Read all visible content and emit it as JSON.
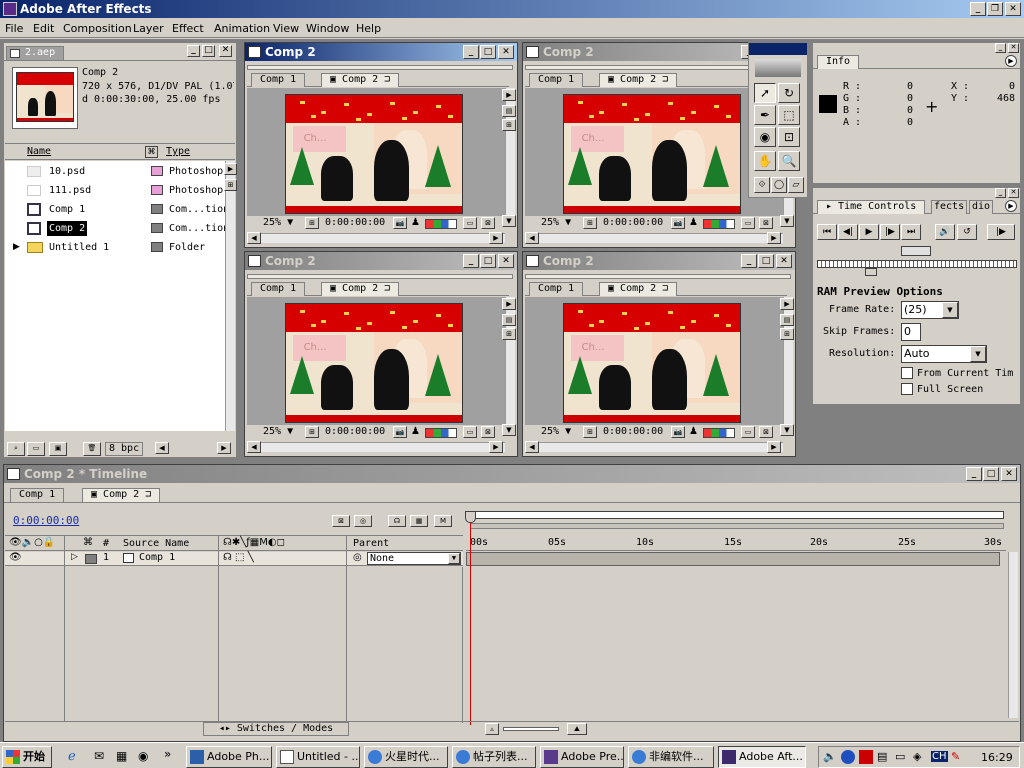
{
  "app": {
    "title": "Adobe After Effects"
  },
  "menu": [
    "File",
    "Edit",
    "Composition",
    "Layer",
    "Effect",
    "Animation",
    "View",
    "Window",
    "Help"
  ],
  "project": {
    "tab": "2.aep",
    "preview_name": "Comp 2",
    "preview_info1": "720 x 576, D1/DV PAL (1.07",
    "preview_info2": "d 0:00:30:00, 25.00 fps",
    "col_name": "Name",
    "col_type": "Type",
    "items": [
      {
        "name": "10.psd",
        "type": "Photoshop",
        "color": "#e8a0d8"
      },
      {
        "name": "111.psd",
        "type": "Photoshop",
        "color": "#e8a0d8"
      },
      {
        "name": "Comp 1",
        "type": "Com...tion",
        "color": "#808080"
      },
      {
        "name": "Comp 2",
        "type": "Com...tion",
        "color": "#808080"
      },
      {
        "name": "Untitled 1",
        "type": "Folder",
        "color": "#808080"
      }
    ],
    "bpc": "8 bpc"
  },
  "comp_windows": [
    {
      "title": "Comp 2",
      "tab1": "Comp 1",
      "tab2": "Comp 2",
      "zoom": "25%",
      "time": "0:00:00:00"
    },
    {
      "title": "Comp 2",
      "tab1": "Comp 1",
      "tab2": "Comp 2",
      "zoom": "25%",
      "time": "0:00:00:00"
    },
    {
      "title": "Comp 2",
      "tab1": "Comp 1",
      "tab2": "Comp 2",
      "zoom": "25%",
      "time": "0:00:00:00"
    },
    {
      "title": "Comp 2",
      "tab1": "Comp 1",
      "tab2": "Comp 2",
      "zoom": "25%",
      "time": "0:00:00:00"
    }
  ],
  "comp_image": {
    "text": "Ch..."
  },
  "info": {
    "tab": "Info",
    "r": "R :",
    "g": "G :",
    "b": "B :",
    "a": "A :",
    "r_val": "0",
    "g_val": "0",
    "b_val": "0",
    "a_val": "0",
    "x": "X :",
    "y": "Y :",
    "x_val": "0",
    "y_val": "468"
  },
  "time_controls": {
    "tab": "Time Controls",
    "tab2": "fects",
    "tab3": "dio",
    "ram_title": "RAM Preview Options",
    "frame_rate_label": "Frame Rate:",
    "frame_rate_value": "(25)",
    "skip_frames_label": "Skip Frames:",
    "skip_frames_value": "0",
    "resolution_label": "Resolution:",
    "resolution_value": "Auto",
    "from_current": "From Current Tim",
    "full_screen": "Full Screen"
  },
  "timeline": {
    "title": "Comp 2 * Timeline",
    "tab1": "Comp 1",
    "tab2": "Comp 2",
    "time": "0:00:00:00",
    "col_hash": "#",
    "col_source": "Source Name",
    "col_parent": "Parent",
    "ticks": [
      "00s",
      "05s",
      "10s",
      "15s",
      "20s",
      "25s",
      "30s"
    ],
    "layer": {
      "num": "1",
      "name": "Comp 1",
      "parent": "None"
    },
    "switches": "Switches / Modes"
  },
  "taskbar": {
    "start": "开始",
    "clock": "16:29",
    "lang": "CH",
    "buttons": [
      "Adobe Ph...",
      "Untitled - ...",
      "火星时代...",
      "帖子列表...",
      "Adobe Pre...",
      "非编软件...",
      "Adobe Aft..."
    ]
  }
}
